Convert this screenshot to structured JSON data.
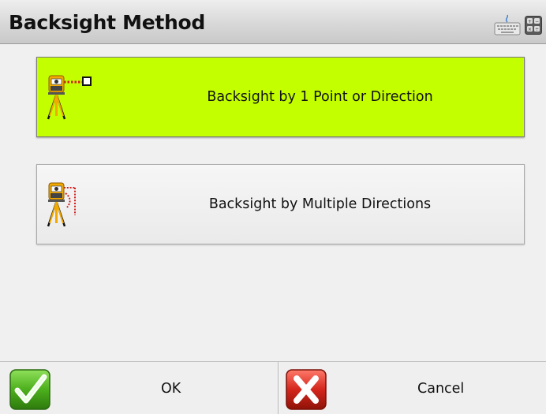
{
  "window": {
    "title": "Backsight Method",
    "keyboard_icon": "keyboard-icon",
    "calculator_icon": "calculator-icon"
  },
  "options": [
    {
      "label": "Backsight by 1 Point or Direction",
      "icon": "total-station-single-point-icon",
      "selected": true,
      "highlight_color": "#c4ff00"
    },
    {
      "label": "Backsight by Multiple Directions",
      "icon": "total-station-multiple-directions-icon",
      "selected": false
    }
  ],
  "footer": {
    "ok_label": "OK",
    "ok_icon": "green-check-icon",
    "cancel_label": "Cancel",
    "cancel_icon": "red-x-icon"
  },
  "colors": {
    "accent_green": "#4caf1c",
    "cancel_red": "#d4261c",
    "instrument_orange": "#f2a900"
  }
}
